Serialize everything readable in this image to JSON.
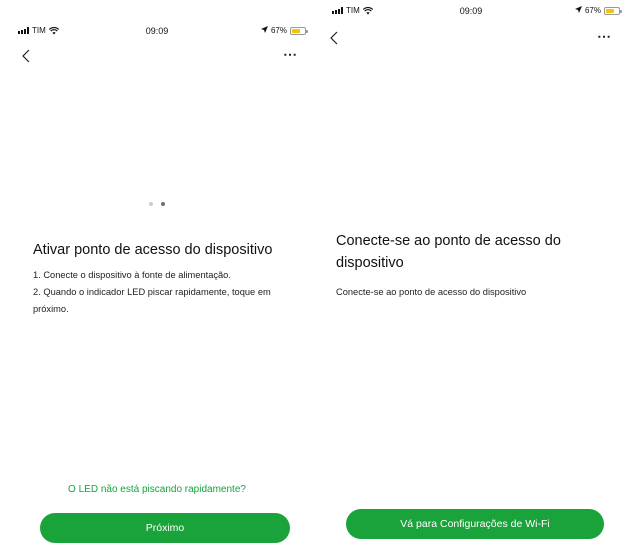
{
  "left_screen": {
    "status_bar": {
      "carrier": "TIM",
      "time": "09:09",
      "battery": "67%",
      "battery_level": 0.67
    },
    "more_label": "⋯",
    "pager": {
      "total": 2,
      "active_index": 1
    },
    "title": "Ativar ponto de acesso do dispositivo",
    "steps": [
      "1. Conecte o dispositivo à fonte de alimentação.",
      "2. Quando o indicador LED piscar rapidamente, toque em próximo."
    ],
    "help_link": "O LED não está piscando rapidamente?",
    "next_button": "Próximo"
  },
  "right_screen": {
    "status_bar": {
      "carrier": "TIM",
      "time": "09:09",
      "battery": "67%",
      "battery_level": 0.67
    },
    "more_label": "⋯",
    "title": "Conecte-se ao ponto de acesso do dispositivo",
    "description": "Conecte-se ao ponto de acesso do dispositivo",
    "wifi_button": "Vá para Configurações de Wi-Fi"
  },
  "colors": {
    "accent": "#1aa33a",
    "link": "#14a33e",
    "battery": "#f2c500"
  },
  "icons": [
    "signal-icon",
    "wifi-icon",
    "location-arrow-icon",
    "battery-icon",
    "back-chevron-icon",
    "more-icon"
  ]
}
